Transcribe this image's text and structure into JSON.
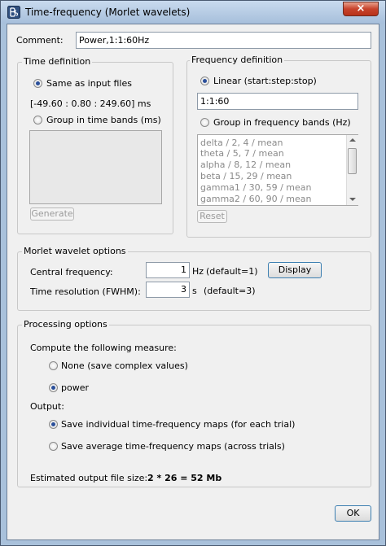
{
  "window": {
    "title": "Time-frequency (Morlet wavelets)",
    "close_label": "×"
  },
  "comment": {
    "label": "Comment:",
    "value": "Power,1:1:60Hz"
  },
  "time_definition": {
    "title": "Time definition",
    "same_as_input": "Same as input files",
    "time_range": "[-49.60 : 0.80 : 249.60] ms",
    "group_in_bands": "Group in time bands (ms)",
    "generate_label": "Generate"
  },
  "frequency_definition": {
    "title": "Frequency definition",
    "linear_label": "Linear (start:step:stop)",
    "linear_value": "1:1:60",
    "group_in_bands": "Group in frequency bands (Hz)",
    "bands": [
      "delta / 2, 4 / mean",
      "theta / 5, 7 / mean",
      "alpha / 8, 12 / mean",
      "beta / 15, 29 / mean",
      "gamma1 / 30, 59 / mean",
      "gamma2 / 60, 90 / mean"
    ],
    "reset_label": "Reset"
  },
  "morlet": {
    "title": "Morlet wavelet options",
    "central_label": "Central frequency:",
    "central_value": "1",
    "central_unit": "Hz",
    "central_default": "(default=1)",
    "display_label": "Display",
    "fwhm_label": "Time resolution (FWHM):",
    "fwhm_value": "3",
    "fwhm_unit": "s",
    "fwhm_default": "(default=3)"
  },
  "processing": {
    "title": "Processing options",
    "measure_label": "Compute the following measure:",
    "none_label": "None (save complex values)",
    "power_label": "power",
    "output_label": "Output:",
    "save_individual": "Save individual time-frequency maps (for each trial)",
    "save_average": "Save average time-frequency maps (across trials)",
    "estimated_label": "Estimated output file size:",
    "estimated_value": "2 * 26 = 52 Mb"
  },
  "ok_label": "OK",
  "colors": {
    "title_bar": "#b7cde6",
    "close_button": "#c7432c",
    "radio_selected": "#2a4f9a",
    "focus_border": "#3c7fb1"
  }
}
